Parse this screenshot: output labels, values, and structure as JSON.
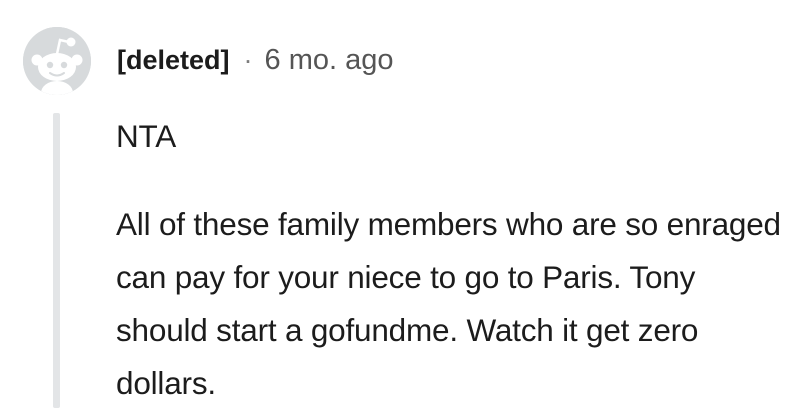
{
  "comment": {
    "author": "[deleted]",
    "separator": "·",
    "timestamp": "6 mo. ago",
    "avatar_icon": "reddit-snoo-icon",
    "paragraphs": [
      "NTA",
      "All of these family members who are so enraged can pay for your niece to go to Paris. Tony should start a gofundme. Watch it get zero dollars."
    ]
  },
  "colors": {
    "avatar_bg": "#d7dadc",
    "avatar_fg": "#ffffff",
    "thread_line": "#e3e5e7",
    "text": "#1c1c1c",
    "muted": "#555555"
  }
}
